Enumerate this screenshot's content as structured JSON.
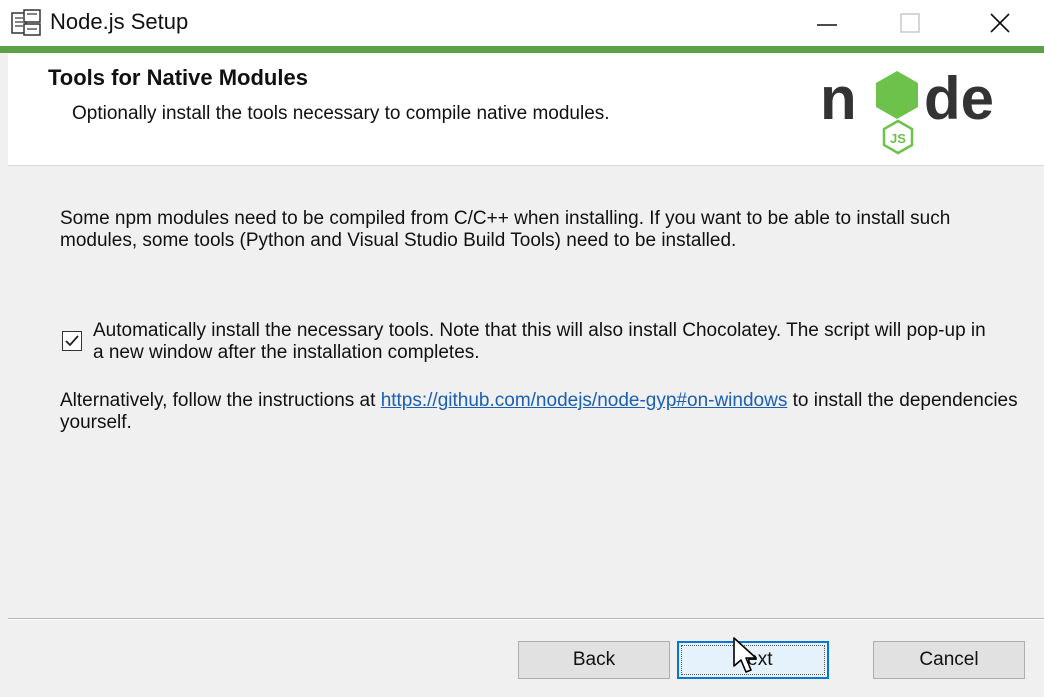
{
  "window": {
    "title": "Node.js Setup",
    "icons": {
      "app": "installer-icon",
      "minimize": "minimize-icon",
      "maximize": "maximize-icon",
      "close": "close-icon"
    }
  },
  "colors": {
    "accent": "#5b9f46",
    "node_dark": "#333333",
    "node_green": "#6cc24a",
    "link": "#1a5fb4",
    "primary_button_border": "#0078d7"
  },
  "banner": {
    "title": "Tools for Native Modules",
    "subtitle": "Optionally install the tools necessary to compile native modules.",
    "logo": {
      "word": "node",
      "badge": "JS"
    }
  },
  "content": {
    "description": "Some npm modules need to be compiled from C/C++ when installing. If you want to be able to install such modules, some tools (Python and Visual Studio Build Tools) need to be installed.",
    "checkbox": {
      "checked": true,
      "label": "Automatically install the necessary tools. Note that this will also install Chocolatey. The script will pop-up in a new window after the installation completes."
    },
    "alternative": {
      "prefix": "Alternatively, follow the instructions at ",
      "link": "https://github.com/nodejs/node-gyp#on-windows",
      "suffix": " to install the dependencies yourself."
    }
  },
  "buttons": {
    "back": "Back",
    "next": "Next",
    "cancel": "Cancel"
  }
}
